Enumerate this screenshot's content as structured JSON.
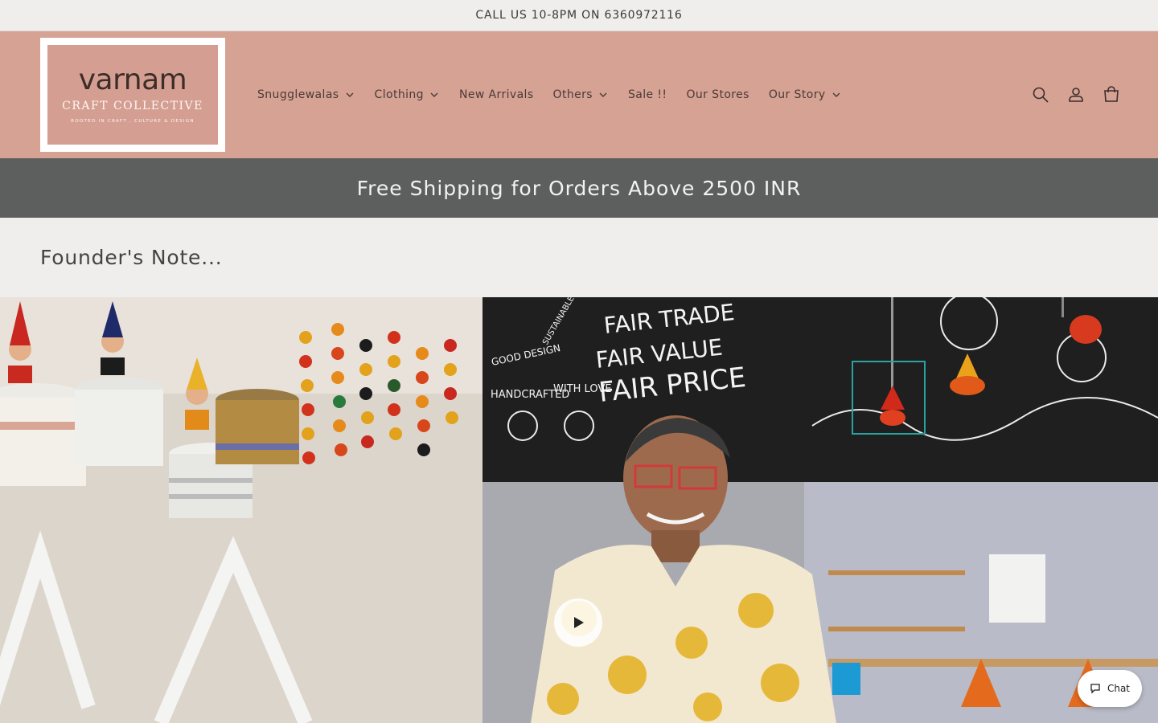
{
  "announcement": {
    "text": "CALL US 10-8PM ON 6360972116"
  },
  "logo": {
    "name": "varnam",
    "subtitle": "CRAFT COLLECTIVE",
    "tagline": "ROOTED IN CRAFT , CULTURE & DESIGN"
  },
  "nav": {
    "items": [
      {
        "label": "Snugglewalas",
        "dropdown": true
      },
      {
        "label": "Clothing",
        "dropdown": true
      },
      {
        "label": "New Arrivals",
        "dropdown": false
      },
      {
        "label": "Others",
        "dropdown": true
      },
      {
        "label": "Sale !!",
        "dropdown": false
      },
      {
        "label": "Our Stores",
        "dropdown": false
      },
      {
        "label": "Our Story",
        "dropdown": true
      }
    ]
  },
  "header_icons": [
    "search-icon",
    "account-icon",
    "cart-icon"
  ],
  "shipping_banner": {
    "text": "Free Shipping for Orders Above 2500 INR"
  },
  "section": {
    "title": "Founder's Note..."
  },
  "video": {
    "chalkboard_lines": [
      "FAIR TRADE",
      "FAIR VALUE",
      "FAIR PRICE"
    ],
    "chalk_side_text": [
      "GOOD DESIGN",
      "SUSTAINABLE LIVELIHOOD",
      "HANDCRAFTED",
      "WITH LOVE"
    ]
  },
  "chat": {
    "label": "Chat"
  },
  "colors": {
    "header_bg": "#d6a294",
    "shipping_bg": "#5c5f5d",
    "page_bg": "#efeeec"
  }
}
